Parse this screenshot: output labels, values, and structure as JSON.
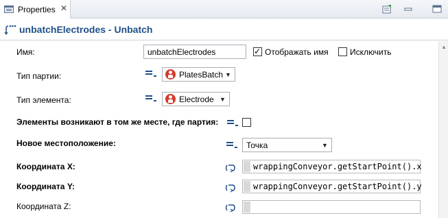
{
  "tab": {
    "label": "Properties",
    "close": "✕"
  },
  "header": {
    "title": "unbatchElectrodes - Unbatch"
  },
  "fields": {
    "name_label": "Имя:",
    "name_value": "unbatchElectrodes",
    "show_name_label": "Отображать имя",
    "show_name_checked": true,
    "exclude_label": "Исключить",
    "exclude_checked": false,
    "batch_type_label": "Тип партии:",
    "batch_type_value": "PlatesBatch",
    "element_type_label": "Тип элемента:",
    "element_type_value": "Electrode",
    "same_place_label": "Элементы возникают в том же месте, где партия:",
    "same_place_checked": false,
    "new_location_label": "Новое местоположение:",
    "new_location_value": "Точка",
    "coord_x_label": "Координата X:",
    "coord_x_value": "wrappingConveyor.getStartPoint().x",
    "coord_y_label": "Координата Y:",
    "coord_y_value": "wrappingConveyor.getStartPoint().y",
    "coord_z_label": "Координата Z:",
    "coord_z_value": ""
  },
  "icons": {
    "tab": "properties-icon",
    "header": "unbatch-icon",
    "static_param": "static-parameter-icon",
    "dynamic_param": "dynamic-parameter-icon",
    "agent": "agent-type-icon"
  },
  "colors": {
    "title": "#1f4f8b",
    "agent": "#d43a2a"
  }
}
